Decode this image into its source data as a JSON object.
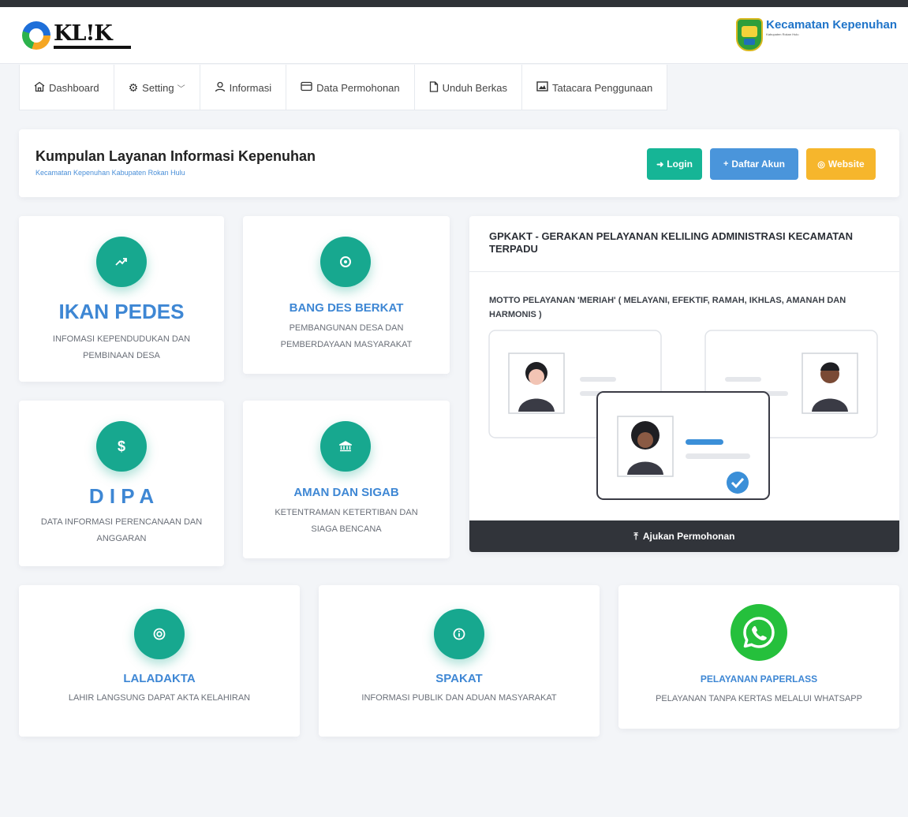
{
  "header": {
    "logo_text": "KL!K",
    "brand_title": "Kecamatan Kepenuhan",
    "brand_subtitle": "Kabupaten Rokan Hulu"
  },
  "nav": {
    "items": [
      {
        "label": "Dashboard",
        "icon": "home-icon"
      },
      {
        "label": "Setting",
        "icon": "gear-icon",
        "has_dropdown": true
      },
      {
        "label": "Informasi",
        "icon": "user-icon"
      },
      {
        "label": "Data Permohonan",
        "icon": "card-icon"
      },
      {
        "label": "Unduh Berkas",
        "icon": "file-icon"
      },
      {
        "label": "Tatacara Penggunaan",
        "icon": "image-icon"
      }
    ],
    "caret": "﹀"
  },
  "title_card": {
    "title": "Kumpulan Layanan Informasi Kepenuhan",
    "subtitle": "Kecamatan Kepenuhan Kabupaten Rokan Hulu",
    "login_label": "Login",
    "daftar_label": "Daftar Akun",
    "website_label": "Website"
  },
  "features": {
    "ikan": {
      "title": "IKAN PEDES",
      "desc": "INFOMASI KEPENDUDUKAN DAN PEMBINAAN DESA",
      "icon": "trend-up-icon"
    },
    "bang": {
      "title": "BANG DES BERKAT",
      "desc": "PEMBANGUNAN DESA DAN PEMBERDAYAAN MASYARAKAT",
      "icon": "gear-icon"
    },
    "dipa": {
      "title": "D I P A",
      "desc": "DATA INFORMASI PERENCANAAN DAN ANGGARAN",
      "icon": "dollar-icon"
    },
    "aman": {
      "title": "AMAN DAN SIGAB",
      "desc": "KETENTRAMAN KETERTIBAN DAN SIAGA BENCANA",
      "icon": "bank-icon"
    },
    "laladakta": {
      "title": "LALADAKTA",
      "desc": "LAHIR LANGSUNG DAPAT AKTA KELAHIRAN",
      "icon": "lifebuoy-icon"
    },
    "spakat": {
      "title": "SPAKAT",
      "desc": "INFORMASI PUBLIK DAN ADUAN MASYARAKAT",
      "icon": "info-icon"
    },
    "paperlass": {
      "title": "PELAYANAN PAPERLASS",
      "desc": "PELAYANAN TANPA KERTAS MELALUI WHATSAPP",
      "icon": "whatsapp-icon"
    }
  },
  "gpkakt": {
    "title": "GPKAKT - GERAKAN PELAYANAN KELILING ADMINISTRASI KECAMATAN TERPADU",
    "motto": "MOTTO PELAYANAN 'MERIAH' ( MELAYANI, EFEKTIF, RAMAH, IKHLAS, AMANAH DAN HARMONIS )",
    "button_label": "Ajukan Permohonan"
  },
  "colors": {
    "teal": "#17a88f",
    "blue": "#4a95db",
    "yellow": "#f6b62c",
    "dark": "#31343a",
    "title_blue": "#3e87d4"
  }
}
